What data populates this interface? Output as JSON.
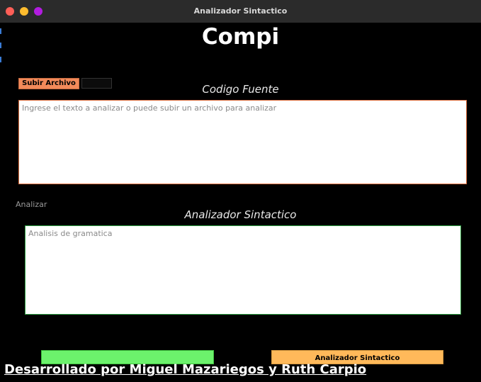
{
  "window": {
    "title": "Analizador Sintactico",
    "controls": [
      {
        "name": "close",
        "color": "#ff5f57"
      },
      {
        "name": "minimize",
        "color": "#febc2e"
      },
      {
        "name": "maximize",
        "color": "#b21ce0"
      }
    ]
  },
  "header": {
    "title": "Compi"
  },
  "upload": {
    "button_label": "Subir Archivo",
    "file_name": ""
  },
  "source": {
    "label": "Codigo Fuente",
    "placeholder": "Ingrese el texto a analizar o puede subir un archivo para analizar",
    "value": ""
  },
  "analyze": {
    "link_label": "Analizar"
  },
  "result": {
    "label": "Analizador Sintactico",
    "placeholder": "Analisis de gramatica",
    "value": ""
  },
  "actions": {
    "left_label": "",
    "right_label": "Analizador Sintactico"
  },
  "footer": {
    "text": "Desarrollado por Miguel Mazariegos y Ruth Carpio"
  },
  "colors": {
    "accent_orange": "#f28a5a",
    "accent_green": "#6cf26c",
    "button_amber": "#ffb95a"
  }
}
